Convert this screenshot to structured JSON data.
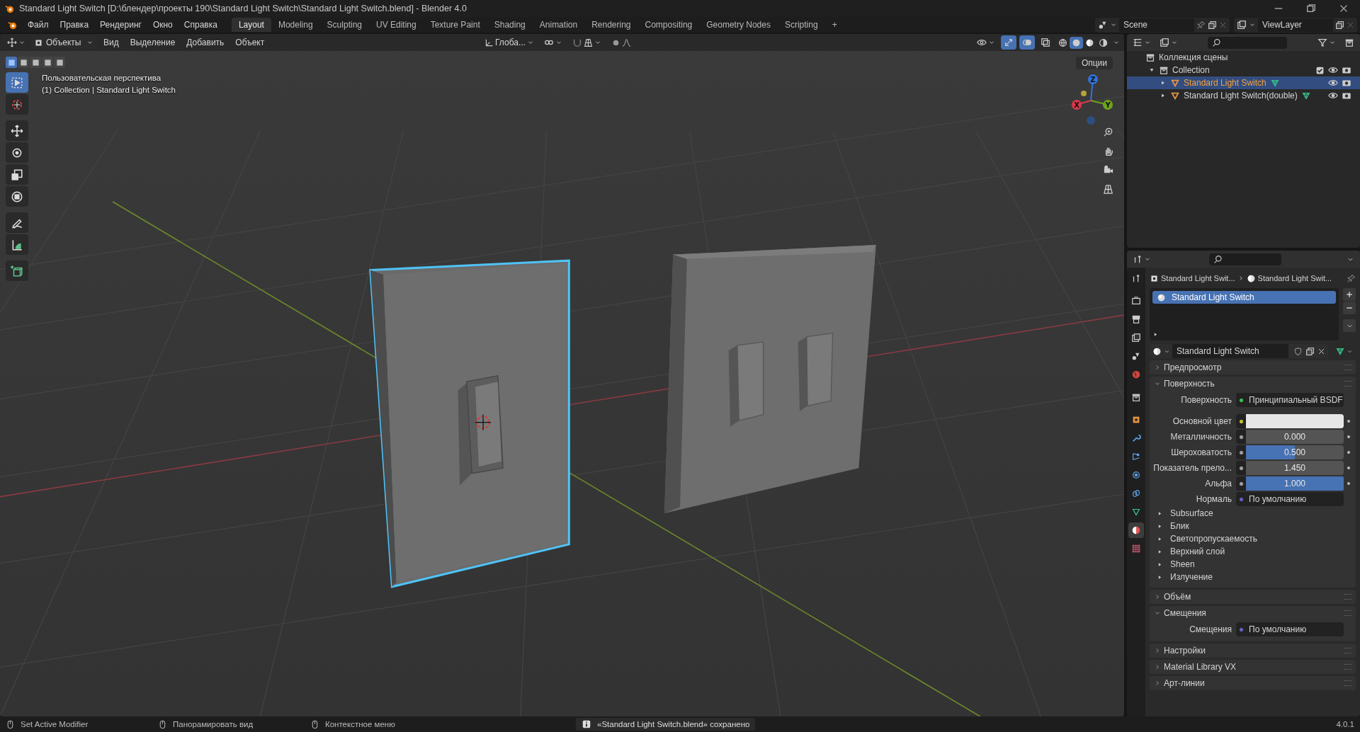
{
  "window": {
    "title": "Standard Light Switch [D:\\блендер\\проекты 190\\Standard Light Switch\\Standard Light Switch.blend] - Blender 4.0"
  },
  "menu": [
    "Файл",
    "Правка",
    "Рендеринг",
    "Окно",
    "Справка"
  ],
  "workspaces": [
    {
      "label": "Layout",
      "selected": true
    },
    {
      "label": "Modeling",
      "selected": false
    },
    {
      "label": "Sculpting",
      "selected": false
    },
    {
      "label": "UV Editing",
      "selected": false
    },
    {
      "label": "Texture Paint",
      "selected": false
    },
    {
      "label": "Shading",
      "selected": false
    },
    {
      "label": "Animation",
      "selected": false
    },
    {
      "label": "Rendering",
      "selected": false
    },
    {
      "label": "Compositing",
      "selected": false
    },
    {
      "label": "Geometry Nodes",
      "selected": false
    },
    {
      "label": "Scripting",
      "selected": false
    }
  ],
  "add_workspace": "+",
  "scene": "Scene",
  "view_layer": "ViewLayer",
  "viewport": {
    "mode": "Объекты",
    "menus": [
      "Вид",
      "Выделение",
      "Добавить",
      "Объект"
    ],
    "orientation": "Глоба...",
    "options": "Опции",
    "select_modes": [
      {
        "selected": true
      },
      {
        "selected": false
      },
      {
        "selected": false
      },
      {
        "selected": false
      },
      {
        "selected": false
      }
    ],
    "toggles": [
      {
        "kind": "gizmo",
        "on": true
      },
      {
        "kind": "overlay",
        "on": true
      },
      {
        "kind": "xray",
        "on": false
      }
    ],
    "shading": [
      {
        "kind": "wireframe",
        "selected": false
      },
      {
        "kind": "solid",
        "selected": true
      },
      {
        "kind": "material",
        "selected": false
      },
      {
        "kind": "rendered",
        "selected": false
      }
    ],
    "overlay_text": [
      "Пользовательская перспектива",
      "(1) Collection | Standard Light Switch"
    ],
    "tools": [
      {
        "kind": "select",
        "selected": true
      },
      {
        "kind": "cursor",
        "selected": false
      },
      {
        "kind": "move",
        "selected": false
      },
      {
        "kind": "rotate",
        "selected": false
      },
      {
        "kind": "scale",
        "selected": false
      },
      {
        "kind": "transform",
        "selected": false
      },
      {
        "kind": "annotate",
        "selected": false
      },
      {
        "kind": "measure",
        "selected": false
      },
      {
        "kind": "add-cube",
        "selected": false
      }
    ],
    "gizmo_axes": [
      {
        "label": "Z",
        "color": "#2f74d9"
      },
      {
        "label": "X",
        "color": "#d9384a"
      },
      {
        "label": "Y",
        "color": "#6ea31d"
      }
    ]
  },
  "outliner": {
    "root": "Коллекция сцены",
    "collection": {
      "label": "Collection",
      "checked": true,
      "expanded": true,
      "children": [
        {
          "label": "Standard Light Switch",
          "selected": true
        },
        {
          "label": "Standard Light Switch(double)",
          "selected": false
        }
      ]
    }
  },
  "properties": {
    "tabs": [
      {
        "kind": "tool",
        "selected": false
      },
      {
        "kind": "render",
        "selected": false
      },
      {
        "kind": "output",
        "selected": false
      },
      {
        "kind": "view-layer",
        "selected": false
      },
      {
        "kind": "scene",
        "selected": false
      },
      {
        "kind": "world",
        "selected": false
      },
      {
        "kind": "collection",
        "selected": false
      },
      {
        "kind": "object",
        "selected": false
      },
      {
        "kind": "modifier",
        "selected": false
      },
      {
        "kind": "particles",
        "selected": false
      },
      {
        "kind": "physics",
        "selected": false
      },
      {
        "kind": "constraint",
        "selected": false
      },
      {
        "kind": "data",
        "selected": false
      },
      {
        "kind": "material",
        "selected": true
      },
      {
        "kind": "texture",
        "selected": false
      }
    ],
    "breadcrumb": [
      "Standard Light Swit...",
      "Standard Light Swit..."
    ],
    "slots": [
      {
        "label": "Standard Light Switch",
        "selected": true
      }
    ],
    "material": "Standard Light Switch",
    "panels": [
      {
        "label": "Предпросмотр",
        "expanded": false
      },
      {
        "label": "Поверхность",
        "expanded": true,
        "rows": [
          {
            "kind": "shader",
            "label": "Поверхность",
            "value": "Принципиальный BSDF",
            "color": "#3cc04f"
          },
          {
            "kind": "color",
            "label": "Основной цвет",
            "color": "#c7c72b"
          },
          {
            "kind": "slider",
            "label": "Металличность",
            "color": "#a1a1a1",
            "level": 0,
            "reading": "0.000"
          },
          {
            "kind": "slider",
            "label": "Шероховатость",
            "color": "#a1a1a1",
            "level": 0.5,
            "reading": "0.500"
          },
          {
            "kind": "number",
            "label": "Показатель прело...",
            "color": "#a1a1a1",
            "reading": "1.450"
          },
          {
            "kind": "slider",
            "label": "Альфа",
            "color": "#a1a1a1",
            "level": 1,
            "reading": "1.000"
          },
          {
            "kind": "shader",
            "label": "Нормаль",
            "value": "По умолчанию",
            "color": "#6363c7"
          }
        ],
        "subpanels": [
          {
            "label": "Subsurface",
            "expanded": false
          },
          {
            "label": "Блик",
            "expanded": false
          },
          {
            "label": "Светопропускаемость",
            "expanded": false
          },
          {
            "label": "Верхний слой",
            "expanded": false
          },
          {
            "label": "Sheen",
            "expanded": false
          },
          {
            "label": "Излучение",
            "expanded": false
          }
        ]
      },
      {
        "label": "Объём",
        "expanded": false
      },
      {
        "label": "Смещения",
        "expanded": true,
        "rows": [
          {
            "kind": "shader",
            "label": "Смещения",
            "value": "По умолчанию",
            "color": "#6363c7"
          }
        ]
      },
      {
        "label": "Настройки",
        "expanded": false
      },
      {
        "label": "Material Library VX",
        "expanded": false
      },
      {
        "label": "Арт-линии",
        "expanded": false
      }
    ]
  },
  "status_bar": {
    "hints": [
      "Set Active Modifier",
      "Панорамировать вид",
      "Контекстное меню"
    ],
    "message": "«Standard Light Switch.blend» сохранено",
    "version": "4.0.1"
  }
}
